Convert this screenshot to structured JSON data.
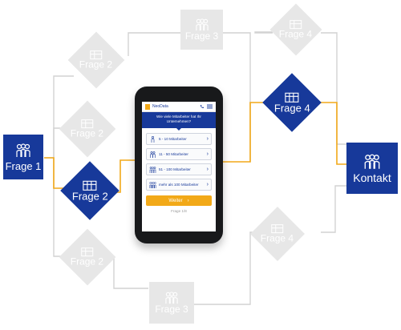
{
  "nodes": {
    "q1": "Frage 1",
    "q2_active": "Frage 2",
    "q2_gray_a": "Frage 2",
    "q2_gray_b": "Frage 2",
    "q2_gray_c": "Frage 2",
    "q3_top": "Frage 3",
    "q3_bottom": "Frage 3",
    "q4_active": "Frage 4",
    "q4_top": "Frage 4",
    "q4_bottom": "Frage 4",
    "contact": "Kontakt"
  },
  "phone": {
    "brand": "NeoData",
    "question": "Wie viele Mitarbeiter hat Ihr Unternehmen?",
    "options": [
      "5 - 10 Mitarbeiter",
      "11 - 50 Mitarbeiter",
      "51 - 100 Mitarbeiter",
      "mehr als 100 Mitarbeiter"
    ],
    "next_label": "Weiter",
    "progress": "Frage 1/8"
  },
  "colors": {
    "blue": "#17399a",
    "accent": "#f2a918",
    "inactive": "#e7e7e7",
    "line": "#d2d2d2"
  }
}
